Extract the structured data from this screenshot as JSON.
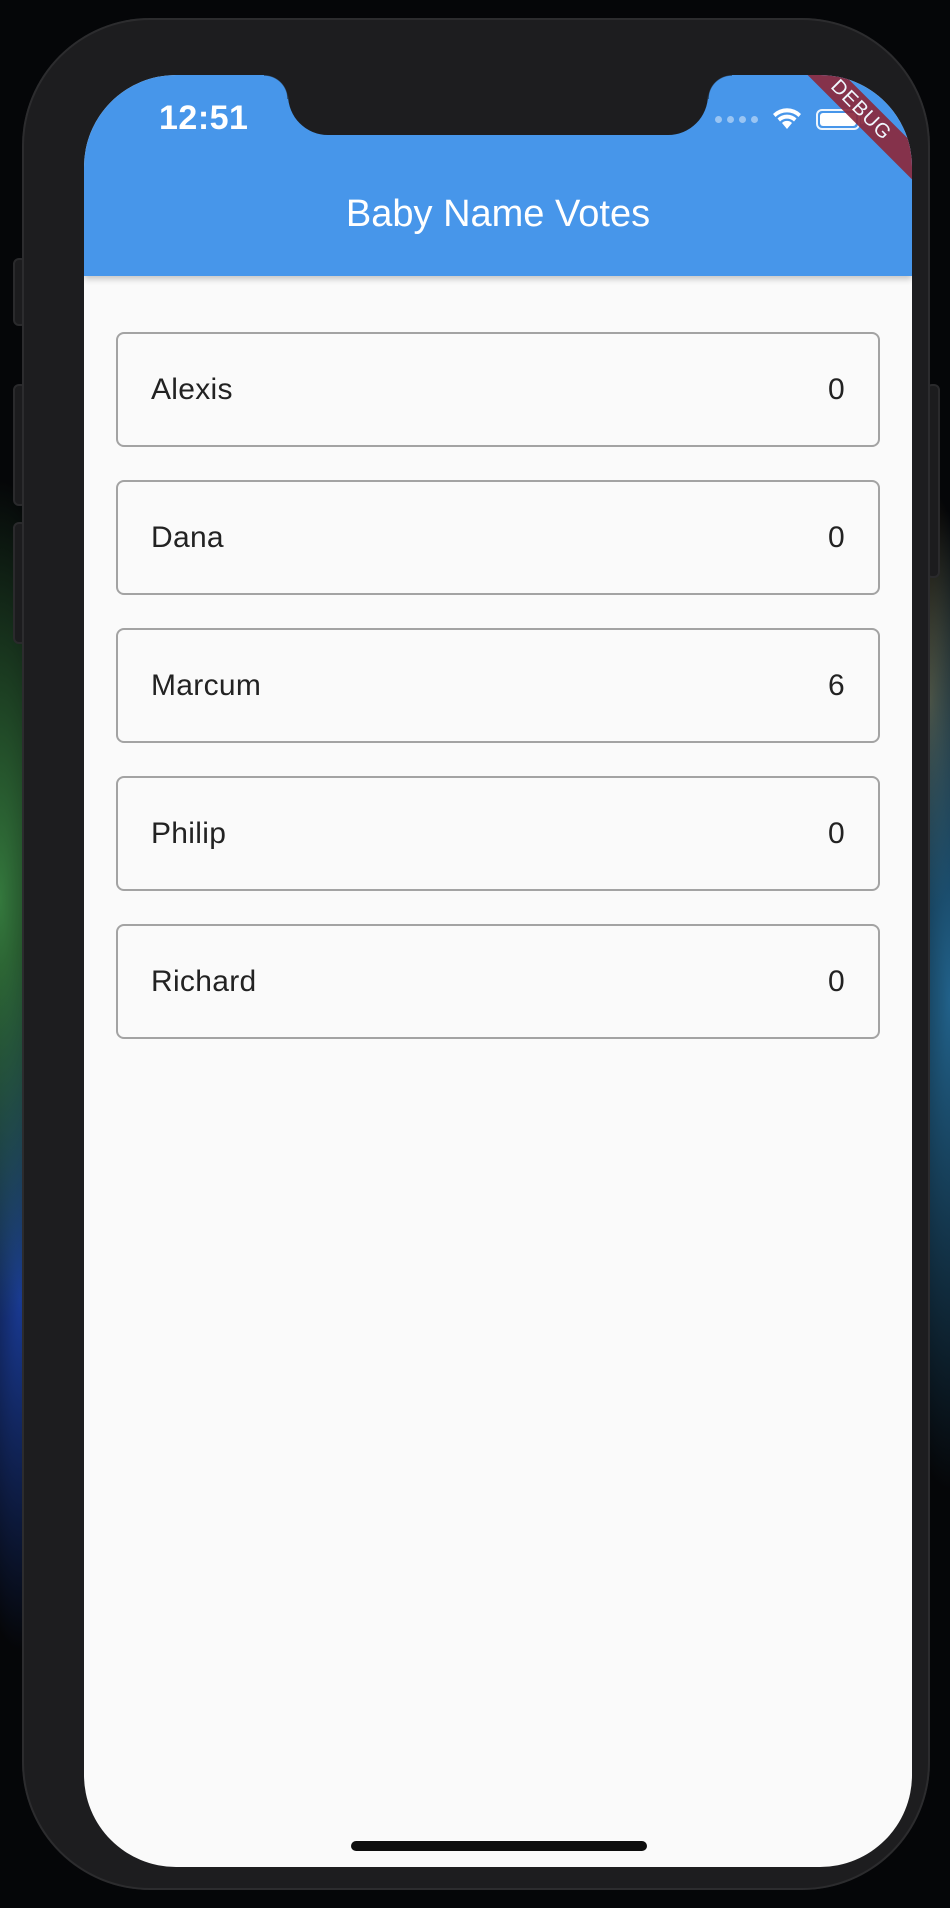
{
  "status_bar": {
    "time": "12:51",
    "icons": [
      "cellular-signal-icon",
      "wifi-icon",
      "battery-icon"
    ]
  },
  "debug_banner": "DEBUG",
  "app_bar": {
    "title": "Baby Name Votes",
    "color": "#4796ea"
  },
  "names": [
    {
      "name": "Alexis",
      "votes": "0"
    },
    {
      "name": "Dana",
      "votes": "0"
    },
    {
      "name": "Marcum",
      "votes": "6"
    },
    {
      "name": "Philip",
      "votes": "0"
    },
    {
      "name": "Richard",
      "votes": "0"
    }
  ]
}
